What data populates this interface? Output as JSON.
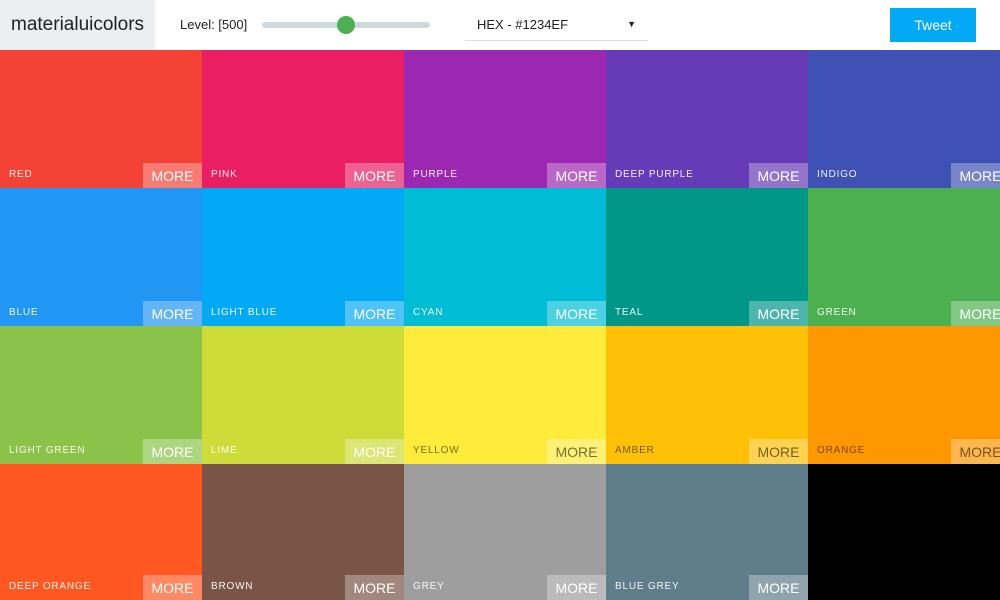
{
  "header": {
    "logo": "materialuicolors",
    "level_label": "Level: [500]",
    "level_value": 0.5,
    "slider_color": "#4caf50",
    "format_selected": "HEX - #1234EF",
    "tweet_label": "Tweet",
    "tweet_color": "#03a9f4"
  },
  "more_label": "MORE",
  "tiles": [
    {
      "name": "RED",
      "color": "#f44336",
      "text": "light"
    },
    {
      "name": "PINK",
      "color": "#e91e63",
      "text": "light"
    },
    {
      "name": "PURPLE",
      "color": "#9c27b0",
      "text": "light"
    },
    {
      "name": "DEEP PURPLE",
      "color": "#673ab7",
      "text": "light"
    },
    {
      "name": "INDIGO",
      "color": "#3f51b5",
      "text": "light"
    },
    {
      "name": "BLUE",
      "color": "#2196f3",
      "text": "light"
    },
    {
      "name": "LIGHT BLUE",
      "color": "#03a9f4",
      "text": "light"
    },
    {
      "name": "CYAN",
      "color": "#00bcd4",
      "text": "light"
    },
    {
      "name": "TEAL",
      "color": "#009688",
      "text": "light"
    },
    {
      "name": "GREEN",
      "color": "#4caf50",
      "text": "light"
    },
    {
      "name": "LIGHT GREEN",
      "color": "#8bc34a",
      "text": "light"
    },
    {
      "name": "LIME",
      "color": "#cddc39",
      "text": "light"
    },
    {
      "name": "YELLOW",
      "color": "#ffeb3b",
      "text": "dark"
    },
    {
      "name": "AMBER",
      "color": "#ffc107",
      "text": "dark"
    },
    {
      "name": "ORANGE",
      "color": "#ff9800",
      "text": "dark"
    },
    {
      "name": "DEEP ORANGE",
      "color": "#ff5722",
      "text": "light"
    },
    {
      "name": "BROWN",
      "color": "#795548",
      "text": "light"
    },
    {
      "name": "GREY",
      "color": "#9e9e9e",
      "text": "light"
    },
    {
      "name": "BLUE GREY",
      "color": "#607d8b",
      "text": "light"
    },
    {
      "name": "",
      "color": "#000000",
      "text": "none"
    }
  ]
}
